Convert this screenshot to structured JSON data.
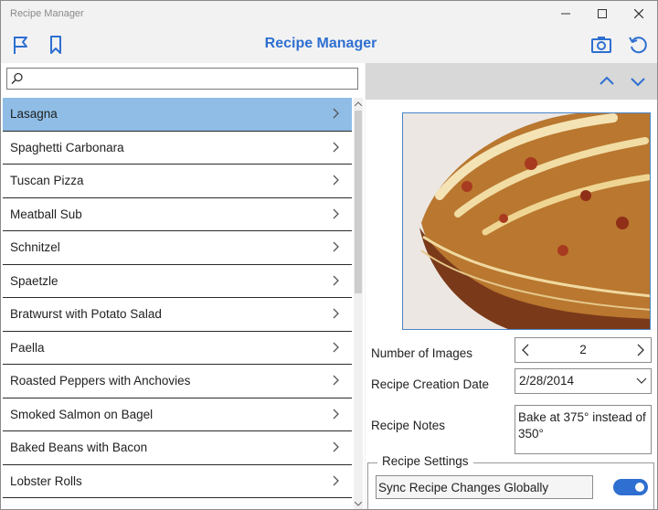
{
  "window": {
    "title": "Recipe Manager",
    "controls": {
      "minimize": "—",
      "maximize": "☐",
      "close": "✕"
    }
  },
  "toolbar": {
    "app_title": "Recipe Manager",
    "icons": [
      "flag-icon",
      "bookmark-icon",
      "camera-icon",
      "refresh-icon"
    ]
  },
  "search": {
    "value": "",
    "placeholder": ""
  },
  "recipes": [
    {
      "label": "Lasagna",
      "selected": true
    },
    {
      "label": "Spaghetti Carbonara"
    },
    {
      "label": "Tuscan Pizza"
    },
    {
      "label": "Meatball Sub"
    },
    {
      "label": "Schnitzel"
    },
    {
      "label": "Spaetzle"
    },
    {
      "label": "Bratwurst with Potato Salad"
    },
    {
      "label": "Paella"
    },
    {
      "label": "Roasted Peppers with Anchovies"
    },
    {
      "label": "Smoked Salmon on Bagel"
    },
    {
      "label": "Baked Beans with Bacon"
    },
    {
      "label": "Lobster Rolls"
    }
  ],
  "detail": {
    "number_of_images_label": "Number of Images",
    "number_of_images": "2",
    "creation_date_label": "Recipe Creation Date",
    "creation_date": "2/28/2014",
    "notes_label": "Recipe Notes",
    "notes": "Bake at 375° instead of 350°",
    "settings_group": "Recipe Settings",
    "sync_label": "Sync Recipe Changes Globally",
    "sync_on": true
  },
  "colors": {
    "accent": "#2e6fd1",
    "selection": "#8fbde6",
    "nav_bar": "#d8d8d8"
  }
}
